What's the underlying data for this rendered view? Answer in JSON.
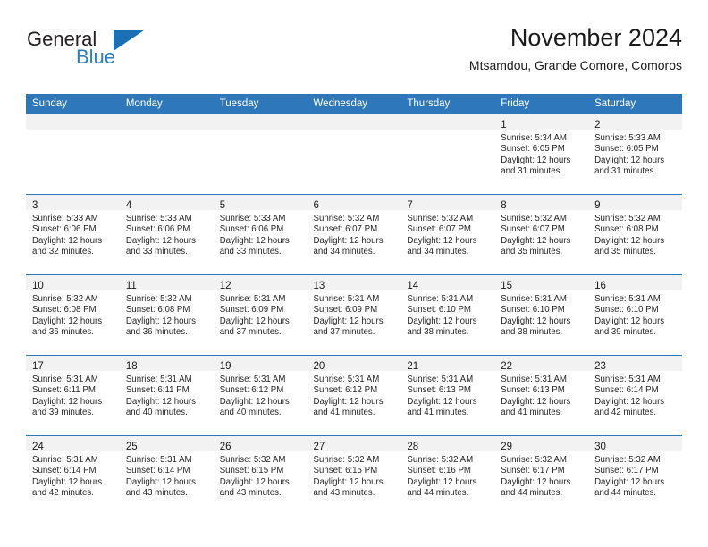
{
  "brand": {
    "name_part1": "General",
    "name_part2": "Blue",
    "flag_icon": "blue-triangle-flag-icon",
    "accent_color": "#2a7fc2"
  },
  "header": {
    "title": "November 2024",
    "subtitle": "Mtsamdou, Grande Comore, Comoros"
  },
  "theme": {
    "header_bg": "#2e77bb",
    "daynum_bg": "#f2f2f2",
    "grid_line": "#2e77bb",
    "text": "#262626"
  },
  "weekdays": [
    "Sunday",
    "Monday",
    "Tuesday",
    "Wednesday",
    "Thursday",
    "Friday",
    "Saturday"
  ],
  "weeks": [
    [
      {
        "day": "",
        "lines": []
      },
      {
        "day": "",
        "lines": []
      },
      {
        "day": "",
        "lines": []
      },
      {
        "day": "",
        "lines": []
      },
      {
        "day": "",
        "lines": []
      },
      {
        "day": "1",
        "lines": [
          "Sunrise: 5:34 AM",
          "Sunset: 6:05 PM",
          "Daylight: 12 hours",
          "and 31 minutes."
        ]
      },
      {
        "day": "2",
        "lines": [
          "Sunrise: 5:33 AM",
          "Sunset: 6:05 PM",
          "Daylight: 12 hours",
          "and 31 minutes."
        ]
      }
    ],
    [
      {
        "day": "3",
        "lines": [
          "Sunrise: 5:33 AM",
          "Sunset: 6:06 PM",
          "Daylight: 12 hours",
          "and 32 minutes."
        ]
      },
      {
        "day": "4",
        "lines": [
          "Sunrise: 5:33 AM",
          "Sunset: 6:06 PM",
          "Daylight: 12 hours",
          "and 33 minutes."
        ]
      },
      {
        "day": "5",
        "lines": [
          "Sunrise: 5:33 AM",
          "Sunset: 6:06 PM",
          "Daylight: 12 hours",
          "and 33 minutes."
        ]
      },
      {
        "day": "6",
        "lines": [
          "Sunrise: 5:32 AM",
          "Sunset: 6:07 PM",
          "Daylight: 12 hours",
          "and 34 minutes."
        ]
      },
      {
        "day": "7",
        "lines": [
          "Sunrise: 5:32 AM",
          "Sunset: 6:07 PM",
          "Daylight: 12 hours",
          "and 34 minutes."
        ]
      },
      {
        "day": "8",
        "lines": [
          "Sunrise: 5:32 AM",
          "Sunset: 6:07 PM",
          "Daylight: 12 hours",
          "and 35 minutes."
        ]
      },
      {
        "day": "9",
        "lines": [
          "Sunrise: 5:32 AM",
          "Sunset: 6:08 PM",
          "Daylight: 12 hours",
          "and 35 minutes."
        ]
      }
    ],
    [
      {
        "day": "10",
        "lines": [
          "Sunrise: 5:32 AM",
          "Sunset: 6:08 PM",
          "Daylight: 12 hours",
          "and 36 minutes."
        ]
      },
      {
        "day": "11",
        "lines": [
          "Sunrise: 5:32 AM",
          "Sunset: 6:08 PM",
          "Daylight: 12 hours",
          "and 36 minutes."
        ]
      },
      {
        "day": "12",
        "lines": [
          "Sunrise: 5:31 AM",
          "Sunset: 6:09 PM",
          "Daylight: 12 hours",
          "and 37 minutes."
        ]
      },
      {
        "day": "13",
        "lines": [
          "Sunrise: 5:31 AM",
          "Sunset: 6:09 PM",
          "Daylight: 12 hours",
          "and 37 minutes."
        ]
      },
      {
        "day": "14",
        "lines": [
          "Sunrise: 5:31 AM",
          "Sunset: 6:10 PM",
          "Daylight: 12 hours",
          "and 38 minutes."
        ]
      },
      {
        "day": "15",
        "lines": [
          "Sunrise: 5:31 AM",
          "Sunset: 6:10 PM",
          "Daylight: 12 hours",
          "and 38 minutes."
        ]
      },
      {
        "day": "16",
        "lines": [
          "Sunrise: 5:31 AM",
          "Sunset: 6:10 PM",
          "Daylight: 12 hours",
          "and 39 minutes."
        ]
      }
    ],
    [
      {
        "day": "17",
        "lines": [
          "Sunrise: 5:31 AM",
          "Sunset: 6:11 PM",
          "Daylight: 12 hours",
          "and 39 minutes."
        ]
      },
      {
        "day": "18",
        "lines": [
          "Sunrise: 5:31 AM",
          "Sunset: 6:11 PM",
          "Daylight: 12 hours",
          "and 40 minutes."
        ]
      },
      {
        "day": "19",
        "lines": [
          "Sunrise: 5:31 AM",
          "Sunset: 6:12 PM",
          "Daylight: 12 hours",
          "and 40 minutes."
        ]
      },
      {
        "day": "20",
        "lines": [
          "Sunrise: 5:31 AM",
          "Sunset: 6:12 PM",
          "Daylight: 12 hours",
          "and 41 minutes."
        ]
      },
      {
        "day": "21",
        "lines": [
          "Sunrise: 5:31 AM",
          "Sunset: 6:13 PM",
          "Daylight: 12 hours",
          "and 41 minutes."
        ]
      },
      {
        "day": "22",
        "lines": [
          "Sunrise: 5:31 AM",
          "Sunset: 6:13 PM",
          "Daylight: 12 hours",
          "and 41 minutes."
        ]
      },
      {
        "day": "23",
        "lines": [
          "Sunrise: 5:31 AM",
          "Sunset: 6:14 PM",
          "Daylight: 12 hours",
          "and 42 minutes."
        ]
      }
    ],
    [
      {
        "day": "24",
        "lines": [
          "Sunrise: 5:31 AM",
          "Sunset: 6:14 PM",
          "Daylight: 12 hours",
          "and 42 minutes."
        ]
      },
      {
        "day": "25",
        "lines": [
          "Sunrise: 5:31 AM",
          "Sunset: 6:14 PM",
          "Daylight: 12 hours",
          "and 43 minutes."
        ]
      },
      {
        "day": "26",
        "lines": [
          "Sunrise: 5:32 AM",
          "Sunset: 6:15 PM",
          "Daylight: 12 hours",
          "and 43 minutes."
        ]
      },
      {
        "day": "27",
        "lines": [
          "Sunrise: 5:32 AM",
          "Sunset: 6:15 PM",
          "Daylight: 12 hours",
          "and 43 minutes."
        ]
      },
      {
        "day": "28",
        "lines": [
          "Sunrise: 5:32 AM",
          "Sunset: 6:16 PM",
          "Daylight: 12 hours",
          "and 44 minutes."
        ]
      },
      {
        "day": "29",
        "lines": [
          "Sunrise: 5:32 AM",
          "Sunset: 6:17 PM",
          "Daylight: 12 hours",
          "and 44 minutes."
        ]
      },
      {
        "day": "30",
        "lines": [
          "Sunrise: 5:32 AM",
          "Sunset: 6:17 PM",
          "Daylight: 12 hours",
          "and 44 minutes."
        ]
      }
    ]
  ]
}
